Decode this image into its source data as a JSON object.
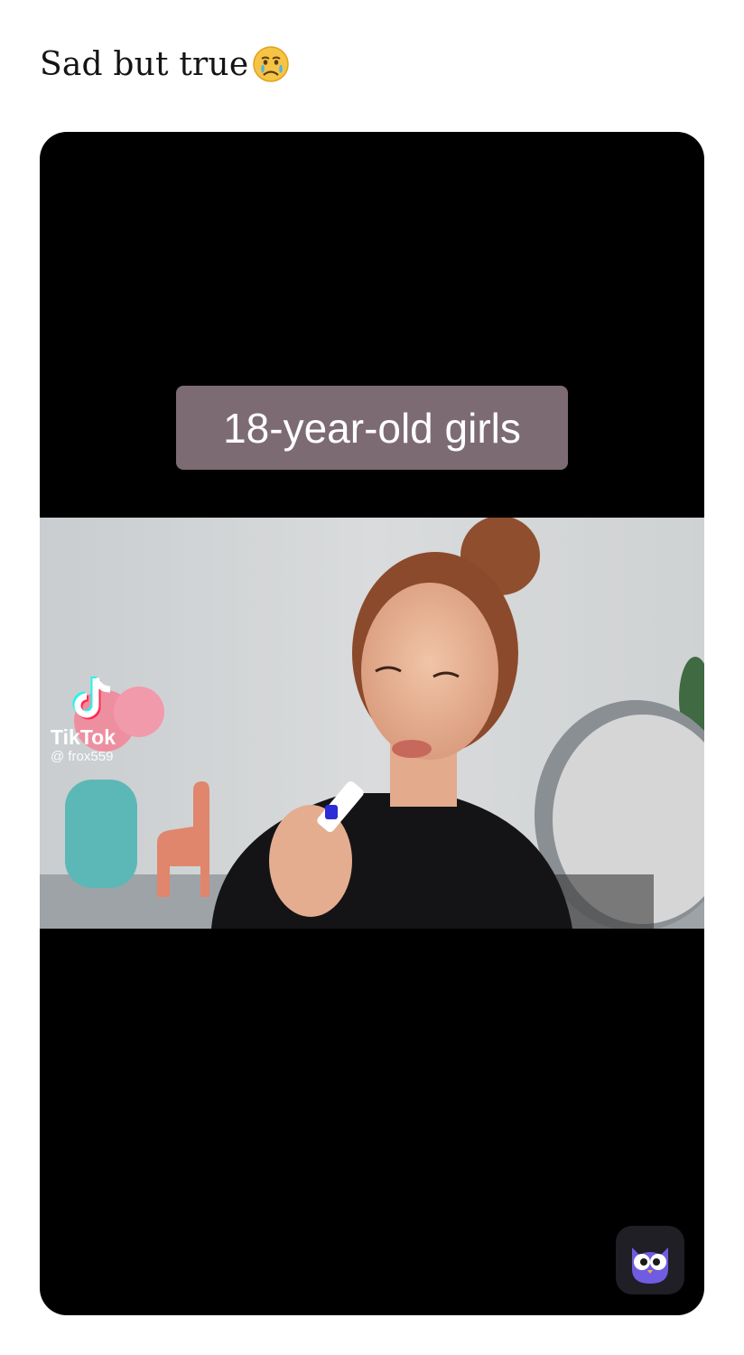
{
  "post": {
    "caption": "Sad but true",
    "caption_emoji": "crying-face-icon"
  },
  "video": {
    "overlay_text": "18-year-old girls",
    "watermark": {
      "brand": "TikTok",
      "handle": "@ frox559"
    }
  },
  "app_badge": {
    "icon": "owl-icon"
  },
  "colors": {
    "background": "#ffffff",
    "video_bg": "#000000",
    "overlay_label": "#7d6b73",
    "badge_bg": "#1f1f25",
    "owl": "#6f5ce0"
  }
}
